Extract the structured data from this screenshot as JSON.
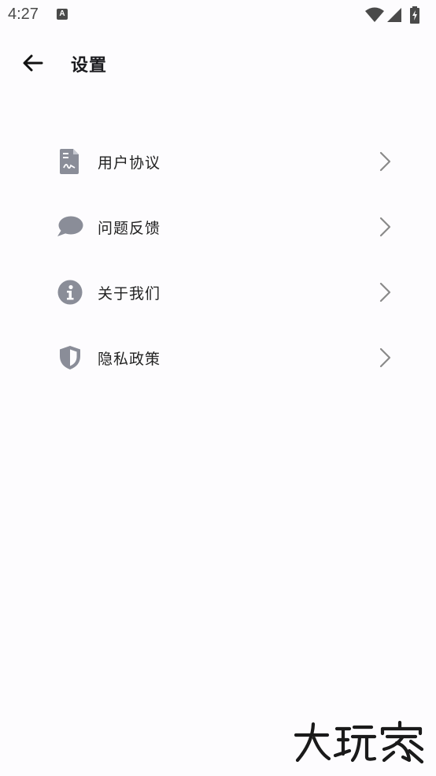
{
  "status_bar": {
    "time": "4:27",
    "notification_badge": "A"
  },
  "header": {
    "title": "设置",
    "back_icon": "arrow-left-icon"
  },
  "menu": {
    "items": [
      {
        "label": "用户协议",
        "icon": "document-signature-icon"
      },
      {
        "label": "问题反馈",
        "icon": "chat-bubble-icon"
      },
      {
        "label": "关于我们",
        "icon": "info-icon"
      },
      {
        "label": "隐私政策",
        "icon": "shield-icon"
      }
    ]
  },
  "watermark": {
    "text": "大玩家"
  },
  "colors": {
    "icon": "#8a8d98",
    "chevron": "#8a8a8a",
    "background": "#fdfcfe"
  }
}
